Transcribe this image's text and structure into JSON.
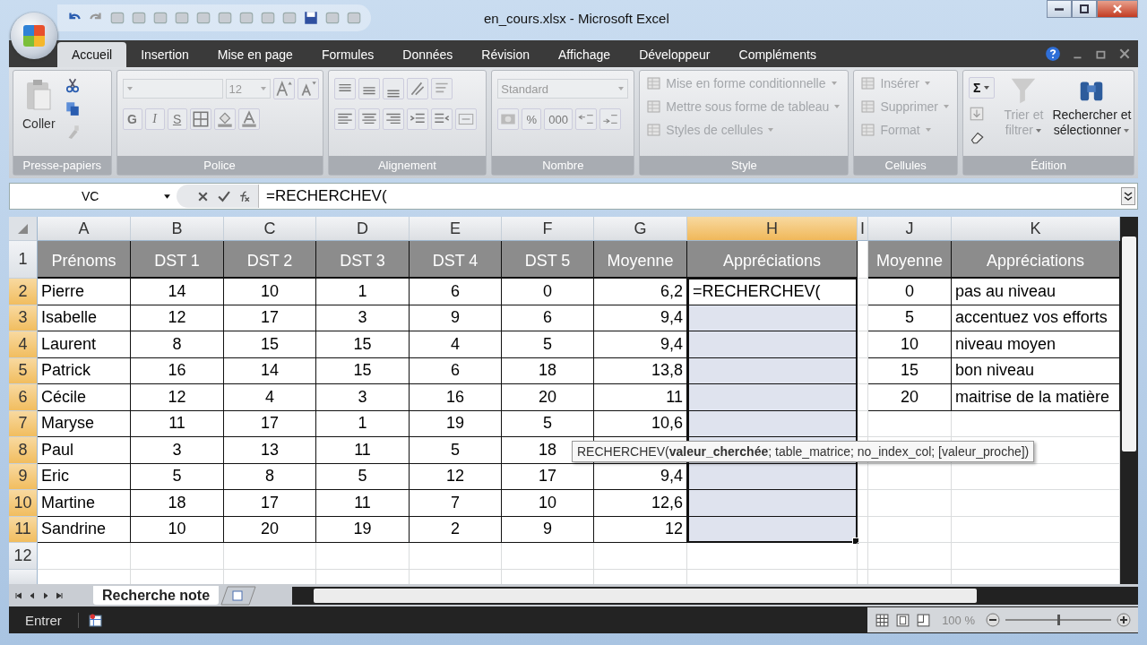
{
  "window": {
    "title": "en_cours.xlsx - Microsoft Excel"
  },
  "tabs": [
    {
      "label": "Accueil",
      "selected": true
    },
    {
      "label": "Insertion",
      "selected": false
    },
    {
      "label": "Mise en page",
      "selected": false
    },
    {
      "label": "Formules",
      "selected": false
    },
    {
      "label": "Données",
      "selected": false
    },
    {
      "label": "Révision",
      "selected": false
    },
    {
      "label": "Affichage",
      "selected": false
    },
    {
      "label": "Développeur",
      "selected": false
    },
    {
      "label": "Compléments",
      "selected": false
    }
  ],
  "ribbon": {
    "groups": [
      {
        "label": "Presse-papiers",
        "kind": "clipboard",
        "paste": "Coller"
      },
      {
        "label": "Police",
        "kind": "font",
        "size": "12",
        "styles": [
          "G",
          "I",
          "S"
        ]
      },
      {
        "label": "Alignement",
        "kind": "alignment"
      },
      {
        "label": "Nombre",
        "kind": "number",
        "format": "Standard",
        "buttons": [
          "%",
          "000"
        ]
      },
      {
        "label": "Style",
        "kind": "commands",
        "commands": [
          {
            "label": "Mise en forme conditionnelle",
            "disabled": true
          },
          {
            "label": "Mettre sous forme de tableau",
            "disabled": true
          },
          {
            "label": "Styles de cellules",
            "disabled": true
          }
        ]
      },
      {
        "label": "Cellules",
        "kind": "commands",
        "commands": [
          {
            "label": "Insérer",
            "disabled": true
          },
          {
            "label": "Supprimer",
            "disabled": true
          },
          {
            "label": "Format",
            "disabled": true
          }
        ]
      },
      {
        "label": "Édition",
        "kind": "editing",
        "sum": "Σ",
        "commands": [
          {
            "label": "Trier et filtrer",
            "disabled": true
          },
          {
            "label": "Rechercher et sélectionner",
            "disabled": false
          }
        ]
      }
    ]
  },
  "formula_bar": {
    "name_box": "VC",
    "formula": "=RECHERCHEV("
  },
  "sheet": {
    "columns": [
      {
        "label": "A",
        "selected": false
      },
      {
        "label": "B",
        "selected": false
      },
      {
        "label": "C",
        "selected": false
      },
      {
        "label": "D",
        "selected": false
      },
      {
        "label": "E",
        "selected": false
      },
      {
        "label": "F",
        "selected": false
      },
      {
        "label": "G",
        "selected": false
      },
      {
        "label": "H",
        "selected": true
      },
      {
        "label": "I",
        "selected": false
      },
      {
        "label": "J",
        "selected": false
      },
      {
        "label": "K",
        "selected": false
      }
    ],
    "row_numbers": [
      {
        "label": "1",
        "selected": false
      },
      {
        "label": "2",
        "selected": true
      },
      {
        "label": "3",
        "selected": true
      },
      {
        "label": "4",
        "selected": true
      },
      {
        "label": "5",
        "selected": true
      },
      {
        "label": "6",
        "selected": true
      },
      {
        "label": "7",
        "selected": true
      },
      {
        "label": "8",
        "selected": true
      },
      {
        "label": "9",
        "selected": true
      },
      {
        "label": "10",
        "selected": true
      },
      {
        "label": "11",
        "selected": true
      },
      {
        "label": "12",
        "selected": false
      }
    ],
    "header": [
      "Prénoms",
      "DST 1",
      "DST 2",
      "DST 3",
      "DST 4",
      "DST 5",
      "Moyenne",
      "Appréciations"
    ],
    "students": [
      {
        "name": "Pierre",
        "grades": [
          "14",
          "10",
          "1",
          "6",
          "0"
        ],
        "average": "6,2",
        "appreciation": "=RECHERCHEV(",
        "selected": false
      },
      {
        "name": "Isabelle",
        "grades": [
          "12",
          "17",
          "3",
          "9",
          "6"
        ],
        "average": "9,4",
        "selected": true
      },
      {
        "name": "Laurent",
        "grades": [
          "8",
          "15",
          "15",
          "4",
          "5"
        ],
        "average": "9,4",
        "selected": true
      },
      {
        "name": "Patrick",
        "grades": [
          "16",
          "14",
          "15",
          "6",
          "18"
        ],
        "average": "13,8",
        "selected": true
      },
      {
        "name": "Cécile",
        "grades": [
          "12",
          "4",
          "3",
          "16",
          "20"
        ],
        "average": "11",
        "selected": true
      },
      {
        "name": "Maryse",
        "grades": [
          "11",
          "17",
          "1",
          "19",
          "5"
        ],
        "average": "10,6",
        "selected": true
      },
      {
        "name": "Paul",
        "grades": [
          "3",
          "13",
          "11",
          "5",
          "18"
        ],
        "selected": true
      },
      {
        "name": "Eric",
        "grades": [
          "5",
          "8",
          "5",
          "12",
          "17"
        ],
        "average": "9,4",
        "selected": true
      },
      {
        "name": "Martine",
        "grades": [
          "18",
          "17",
          "11",
          "7",
          "10"
        ],
        "average": "12,6",
        "selected": true
      },
      {
        "name": "Sandrine",
        "grades": [
          "10",
          "20",
          "19",
          "2",
          "9"
        ],
        "average": "12",
        "selected": true
      }
    ],
    "lookup_header": [
      "Moyenne",
      "Appréciations"
    ],
    "lookup": [
      {
        "threshold": "0",
        "label": "pas au niveau"
      },
      {
        "threshold": "5",
        "label": "accentuez vos efforts"
      },
      {
        "threshold": "10",
        "label": "niveau moyen"
      },
      {
        "threshold": "15",
        "label": "bon niveau"
      },
      {
        "threshold": "20",
        "label": "maitrise de la matière"
      }
    ],
    "tooltip": "RECHERCHEV(**valeur_cherchée**; table_matrice; no_index_col; [valeur_proche])"
  },
  "sheet_tabs": [
    {
      "label": "Recherche note",
      "selected": true
    }
  ],
  "status_bar": {
    "mode": "Entrer",
    "zoom": "100 %",
    "level": 0.5
  }
}
